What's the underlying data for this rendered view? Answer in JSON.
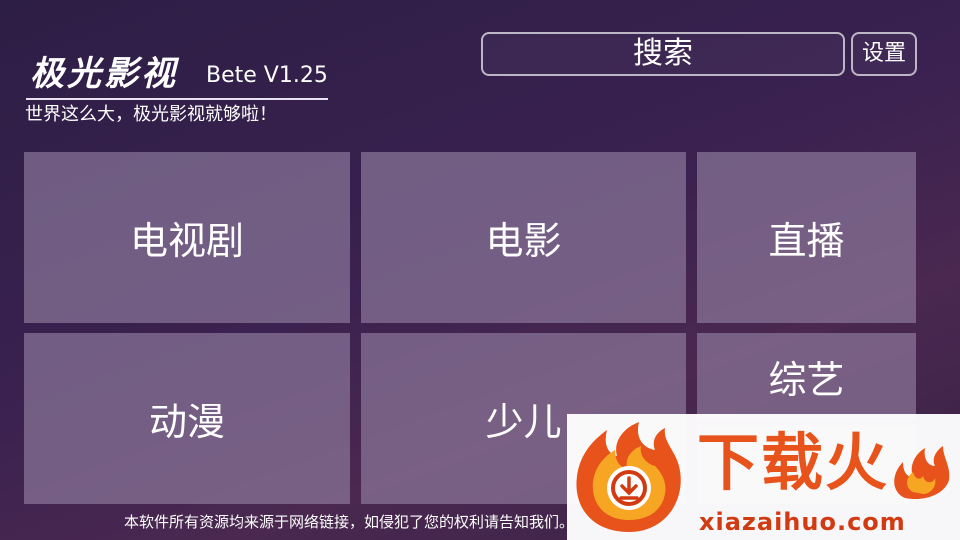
{
  "brand": {
    "name": "极光影视",
    "version": "Bete V1.25",
    "slogan": "世界这么大，极光影视就够啦！"
  },
  "header": {
    "search_label": "搜索",
    "settings_label": "设置"
  },
  "tiles": [
    {
      "label": "电视剧"
    },
    {
      "label": "电影"
    },
    {
      "label": "直播"
    },
    {
      "label": "动漫"
    },
    {
      "label": "少儿"
    },
    {
      "label": "综艺"
    }
  ],
  "footer": {
    "disclaimer": "本软件所有资源均来源于网络链接，如侵犯了您的权利请告知我们。"
  },
  "watermark": {
    "title": "下载火",
    "domain": "xiazaihuo.com",
    "accent_color": "#e8521b"
  },
  "colors": {
    "background": "#35204c",
    "tile": "#8b7a9c"
  }
}
